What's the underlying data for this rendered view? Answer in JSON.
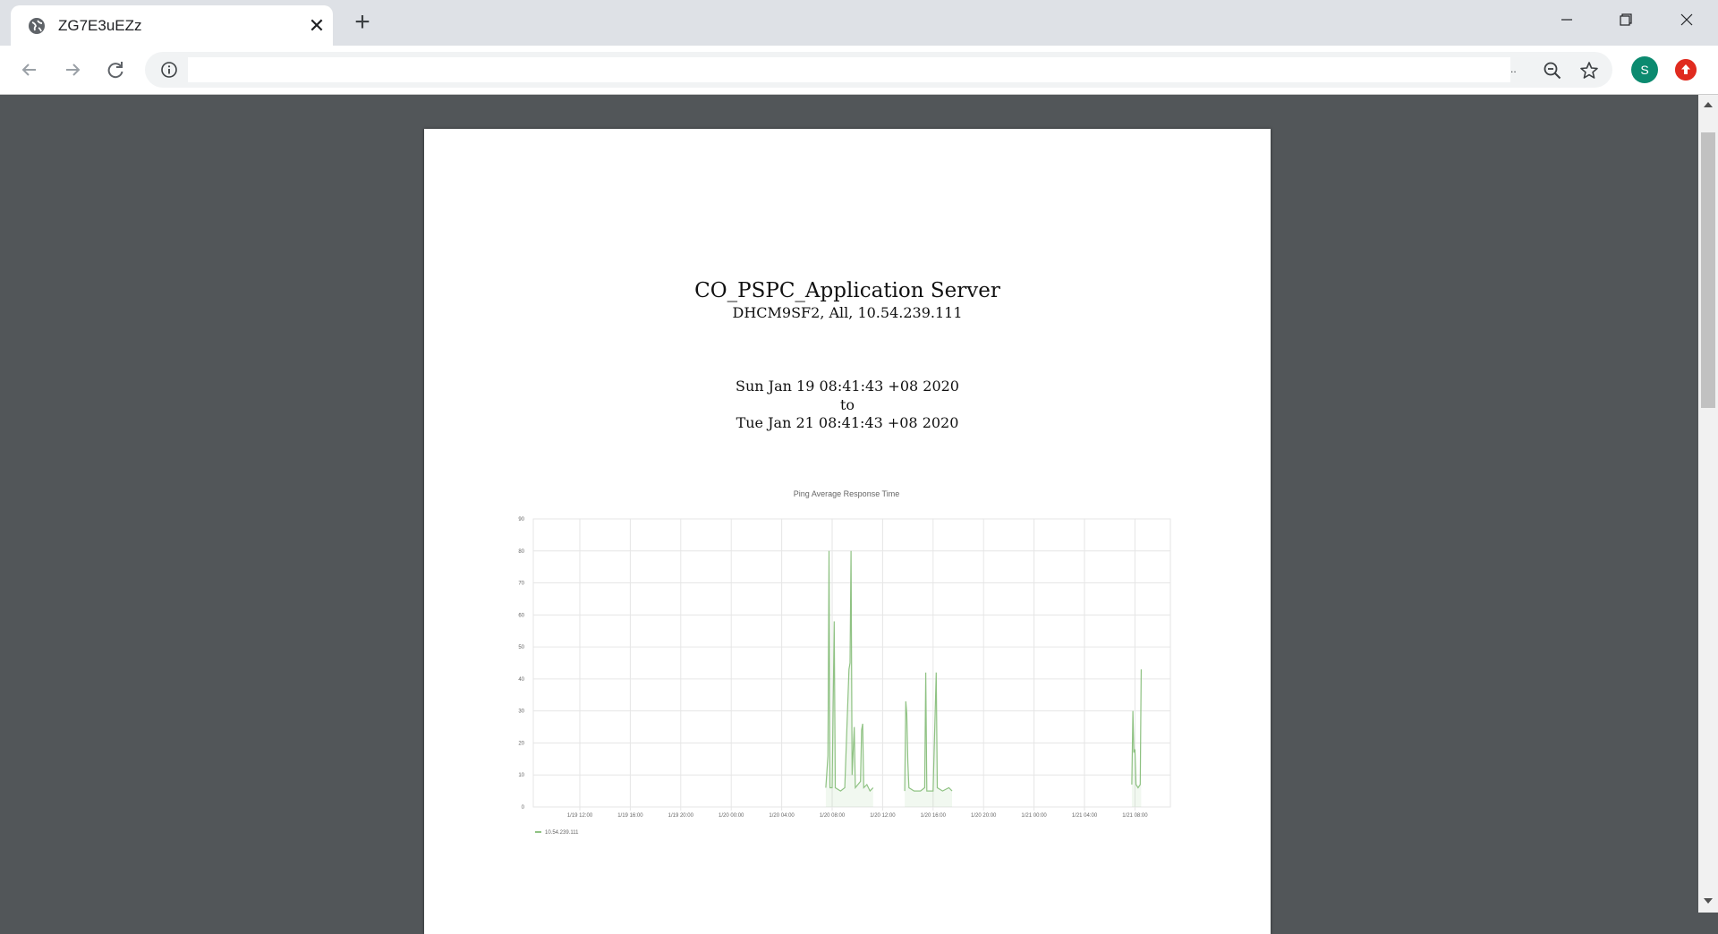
{
  "browser": {
    "tab_title": "ZG7E3uEZz",
    "tab_close": "✕",
    "new_tab": "+",
    "url": "",
    "url_ellipsis": "..",
    "profile_initial": "S"
  },
  "document": {
    "title": "CO_PSPC_Application Server",
    "subtitle": "DHCM9SF2, All, 10.54.239.111",
    "range_start": "Sun Jan 19 08:41:43 +08 2020",
    "range_to": "to",
    "range_end": "Tue Jan 21 08:41:43 +08 2020"
  },
  "chart_data": {
    "type": "line",
    "title": "Ping Average Response Time",
    "xlabel": "",
    "ylabel": "",
    "ylim": [
      0,
      90
    ],
    "y_ticks": [
      "0",
      "10",
      "20",
      "30",
      "40",
      "50",
      "60",
      "70",
      "80",
      "90"
    ],
    "x_ticks": [
      "1/19 12:00",
      "1/19 16:00",
      "1/19 20:00",
      "1/20 00:00",
      "1/20 04:00",
      "1/20 08:00",
      "1/20 12:00",
      "1/20 16:00",
      "1/20 20:00",
      "1/21 00:00",
      "1/21 04:00",
      "1/21 08:00"
    ],
    "grid": true,
    "legend_position": "bottom-left",
    "series": [
      {
        "name": "10.54.239.111",
        "color": "#8fc283",
        "points": [
          [
            "1/20 07:30",
            6
          ],
          [
            "1/20 07:40",
            16
          ],
          [
            "1/20 07:45",
            80
          ],
          [
            "1/20 07:50",
            6
          ],
          [
            "1/20 08:00",
            6
          ],
          [
            "1/20 08:10",
            58
          ],
          [
            "1/20 08:15",
            6
          ],
          [
            "1/20 08:40",
            5
          ],
          [
            "1/20 09:00",
            6
          ],
          [
            "1/20 09:20",
            43
          ],
          [
            "1/20 09:25",
            45
          ],
          [
            "1/20 09:30",
            80
          ],
          [
            "1/20 09:35",
            10
          ],
          [
            "1/20 09:45",
            25
          ],
          [
            "1/20 09:50",
            6
          ],
          [
            "1/20 10:15",
            8
          ],
          [
            "1/20 10:20",
            24
          ],
          [
            "1/20 10:25",
            26
          ],
          [
            "1/20 10:30",
            6
          ],
          [
            "1/20 10:45",
            7
          ],
          [
            "1/20 11:00",
            5
          ],
          [
            "1/20 11:15",
            6
          ],
          [
            "1/20 13:45",
            5
          ],
          [
            "1/20 13:50",
            33
          ],
          [
            "1/20 13:55",
            29
          ],
          [
            "1/20 14:00",
            14
          ],
          [
            "1/20 14:05",
            6
          ],
          [
            "1/20 14:30",
            5
          ],
          [
            "1/20 15:00",
            5
          ],
          [
            "1/20 15:20",
            6
          ],
          [
            "1/20 15:25",
            42
          ],
          [
            "1/20 15:30",
            5
          ],
          [
            "1/20 16:00",
            5
          ],
          [
            "1/20 16:15",
            42
          ],
          [
            "1/20 16:20",
            6
          ],
          [
            "1/20 16:45",
            5
          ],
          [
            "1/20 17:15",
            6
          ],
          [
            "1/20 17:30",
            5
          ],
          [
            "1/21 07:45",
            7
          ],
          [
            "1/21 07:50",
            30
          ],
          [
            "1/21 07:55",
            17
          ],
          [
            "1/21 08:00",
            18
          ],
          [
            "1/21 08:05",
            7
          ],
          [
            "1/21 08:15",
            6
          ],
          [
            "1/21 08:25",
            7
          ],
          [
            "1/21 08:30",
            43
          ]
        ]
      }
    ]
  }
}
